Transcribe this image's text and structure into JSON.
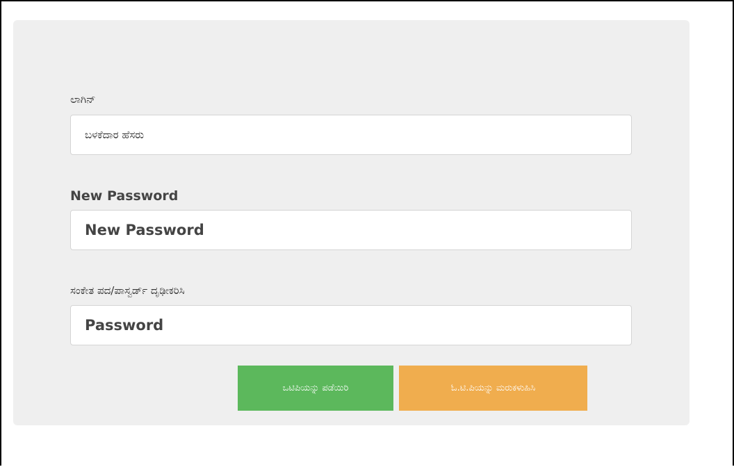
{
  "form": {
    "login_label": "ಲಾಗಿನ್",
    "login_placeholder": "ಬಳಕೆದಾರ ಹೆಸರು",
    "new_password_label": "New Password",
    "new_password_placeholder": "New Password",
    "confirm_label": "ಸಂಕೇತ ಪದ/ಪಾಸ್ವರ್ಡ್ ದೃಢೀಕರಿಸಿ",
    "confirm_placeholder": "Password"
  },
  "buttons": {
    "get_otp": "ಒಟಿಪಿಯನ್ನು ಪಡೆಯಿರಿ",
    "resend_otp": "ಓ.ಟಿ.ಪಿಯನ್ನು ಮರುಕಳುಹಿಸಿ"
  },
  "colors": {
    "panel_bg": "#efefef",
    "green": "#5cb85c",
    "orange": "#f0ad4e"
  }
}
